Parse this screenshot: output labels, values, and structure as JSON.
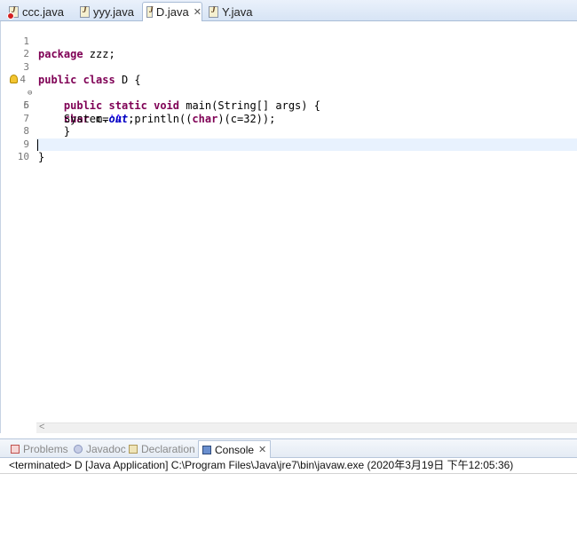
{
  "editor_tabs": [
    {
      "label": "ccc.java",
      "icon": "java-file-error-icon",
      "active": false
    },
    {
      "label": "yyy.java",
      "icon": "java-file-icon",
      "active": false
    },
    {
      "label": "D.java",
      "icon": "java-file-icon",
      "active": true,
      "close": "✕"
    },
    {
      "label": "Y.java",
      "icon": "java-file-icon",
      "active": false
    }
  ],
  "line_numbers": [
    "1",
    "2",
    "3",
    "4",
    "5",
    "6",
    "7",
    "8",
    "9",
    "10"
  ],
  "code": {
    "l1_kw": "package",
    "l1_rest": " zzz;",
    "l3_kw1": "public",
    "l3_kw2": "class",
    "l3_rest": " D {",
    "l4_kw1": "public",
    "l4_kw2": "static",
    "l4_kw3": "void",
    "l4_rest": " main(String[] args) {",
    "l5_kw": "char",
    "l5_rest1": " c=",
    "l5_str": "'A'",
    "l5_rest2": ";",
    "l6_pre": "System.",
    "l6_field": "out",
    "l6_mid": ".println((",
    "l6_kw": "char",
    "l6_post": ")(c=32));",
    "l7": "}",
    "l9": "}"
  },
  "fold_marker": "⊖",
  "scroll_arrow": "<",
  "panel_tabs": [
    {
      "label": "Problems",
      "icon": "problems-icon",
      "active": false
    },
    {
      "label": "Javadoc",
      "icon": "javadoc-icon",
      "active": false
    },
    {
      "label": "Declaration",
      "icon": "declaration-icon",
      "active": false
    },
    {
      "label": "Console",
      "icon": "console-icon",
      "active": true,
      "close": "✕"
    }
  ],
  "console": {
    "status_line": "<terminated> D [Java Application] C:\\Program Files\\Java\\jre7\\bin\\javaw.exe (2020年3月19日 下午12:05:36)"
  },
  "colors": {
    "keyword": "#7f0055",
    "string": "#2a00ff",
    "field": "#0000c0",
    "current_line": "#e8f2fe"
  }
}
